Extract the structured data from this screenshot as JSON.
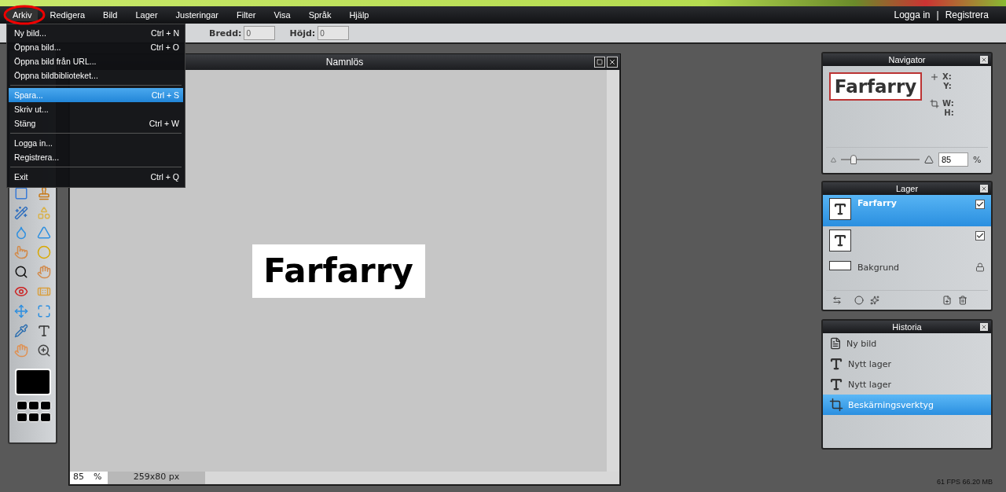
{
  "annotation": {
    "kind": "circle"
  },
  "menubar": {
    "menus": [
      {
        "label": "Arkiv",
        "selected": true
      },
      {
        "label": "Redigera",
        "selected": false
      },
      {
        "label": "Bild",
        "selected": false
      },
      {
        "label": "Lager",
        "selected": false
      },
      {
        "label": "Justeringar",
        "selected": false
      },
      {
        "label": "Filter",
        "selected": false
      },
      {
        "label": "Visa",
        "selected": false
      },
      {
        "label": "Språk",
        "selected": false
      },
      {
        "label": "Hjälp",
        "selected": false
      }
    ],
    "account_links": [
      "Logga in",
      "Registrera"
    ],
    "account_separator": "|"
  },
  "open_menu": {
    "items": [
      {
        "kind": "item",
        "label": "Ny bild...",
        "shortcut": "Ctrl + N",
        "selected": false
      },
      {
        "kind": "item",
        "label": "Öppna bild...",
        "shortcut": "Ctrl + O",
        "selected": false
      },
      {
        "kind": "item",
        "label": "Öppna bild från URL...",
        "selected": false
      },
      {
        "kind": "item",
        "label": "Öppna bildbiblioteket...",
        "selected": false
      },
      {
        "kind": "separator"
      },
      {
        "kind": "item",
        "label": "Spara...",
        "shortcut": "Ctrl + S",
        "selected": true
      },
      {
        "kind": "item",
        "label": "Skriv ut...",
        "selected": false
      },
      {
        "kind": "item",
        "label": "Stäng",
        "shortcut": "Ctrl + W",
        "selected": false
      },
      {
        "kind": "separator"
      },
      {
        "kind": "item",
        "label": "Logga in...",
        "selected": false
      },
      {
        "kind": "item",
        "label": "Registrera...",
        "selected": false
      },
      {
        "kind": "separator"
      },
      {
        "kind": "item",
        "label": "Exit",
        "shortcut": "Ctrl + Q",
        "selected": false
      }
    ]
  },
  "options_bar": {
    "fields": [
      {
        "label": "Bredd:",
        "value": "0"
      },
      {
        "label": "Höjd:",
        "value": "0"
      }
    ]
  },
  "document": {
    "title": "Namnlös",
    "image_text": "Farfarry",
    "zoom": "85",
    "zoom_unit": "%",
    "size": "259x80 px"
  },
  "navigator": {
    "title": "Navigator",
    "preview_text": "Farfarry",
    "position_labels": [
      "X:",
      "Y:"
    ],
    "size_labels": [
      "W:",
      "H:"
    ],
    "zoom_slider": {
      "level": 0.16
    },
    "zoom_value": "85",
    "zoom_unit": "%"
  },
  "layers": {
    "title": "Lager",
    "items": [
      {
        "kind": "text",
        "name": "Farfarry",
        "selected": true,
        "visible": true
      },
      {
        "kind": "text",
        "selected": false,
        "visible": true
      },
      {
        "kind": "background",
        "name": "Bakgrund",
        "selected": false,
        "locked": true
      }
    ]
  },
  "history": {
    "title": "Historia",
    "items": [
      {
        "kind": "new",
        "label": "Ny bild",
        "selected": false
      },
      {
        "kind": "layer",
        "label": "Nytt lager",
        "selected": false
      },
      {
        "kind": "layer",
        "label": "Nytt lager",
        "selected": false
      },
      {
        "kind": "crop",
        "label": "Beskärningsverktyg",
        "selected": true
      }
    ]
  },
  "status": "61 FPS 66.20 MB"
}
